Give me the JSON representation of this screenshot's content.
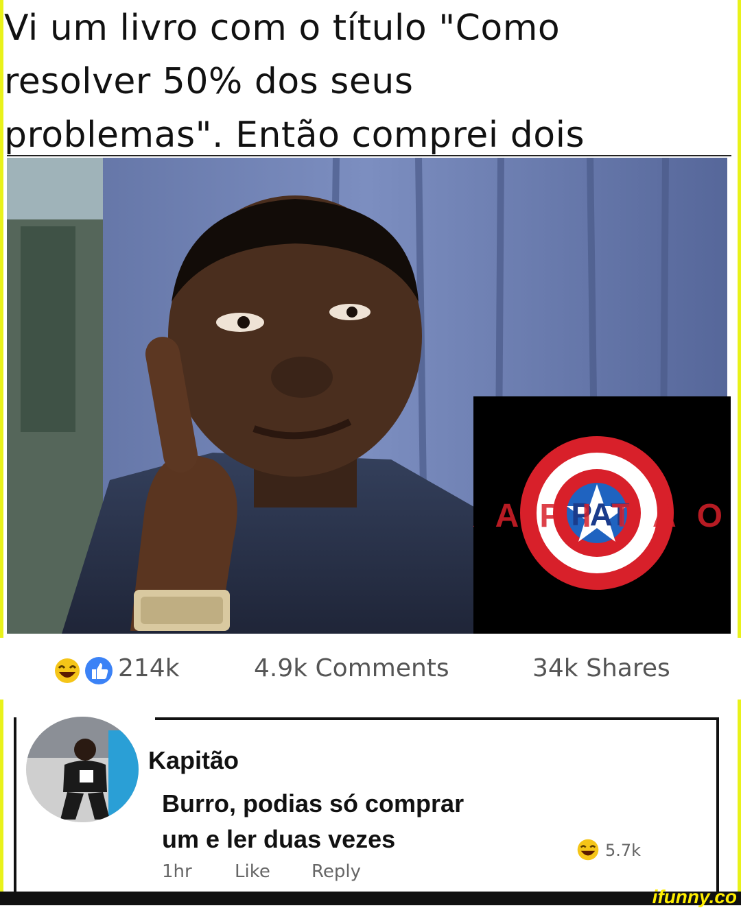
{
  "headline": {
    "line1": "Vi um livro com o título \"Como",
    "line2": "resolver 50% dos seus",
    "line3": "problemas\". Então comprei dois"
  },
  "logo": {
    "text": "KAPITÃO",
    "badge": "PAT"
  },
  "post_stats": {
    "reactions_count": "214k",
    "comments": "4.9k Comments",
    "shares": "34k Shares"
  },
  "comment": {
    "author": "Kapitão",
    "text_line1": "Burro, podias só comprar",
    "text_line2": "um e ler duas vezes",
    "time": "1hr",
    "like_label": "Like",
    "reply_label": "Reply",
    "reaction_count": "5.7k"
  },
  "watermark": "ifunny.co",
  "colors": {
    "accent_yellow": "#e9f21a",
    "like_blue": "#3b82f6",
    "shield_red": "#d8202a",
    "text_gray": "#555555"
  },
  "icons": {
    "haha_reaction": "laughing-emoji-icon",
    "like_reaction": "thumbs-up-icon"
  }
}
